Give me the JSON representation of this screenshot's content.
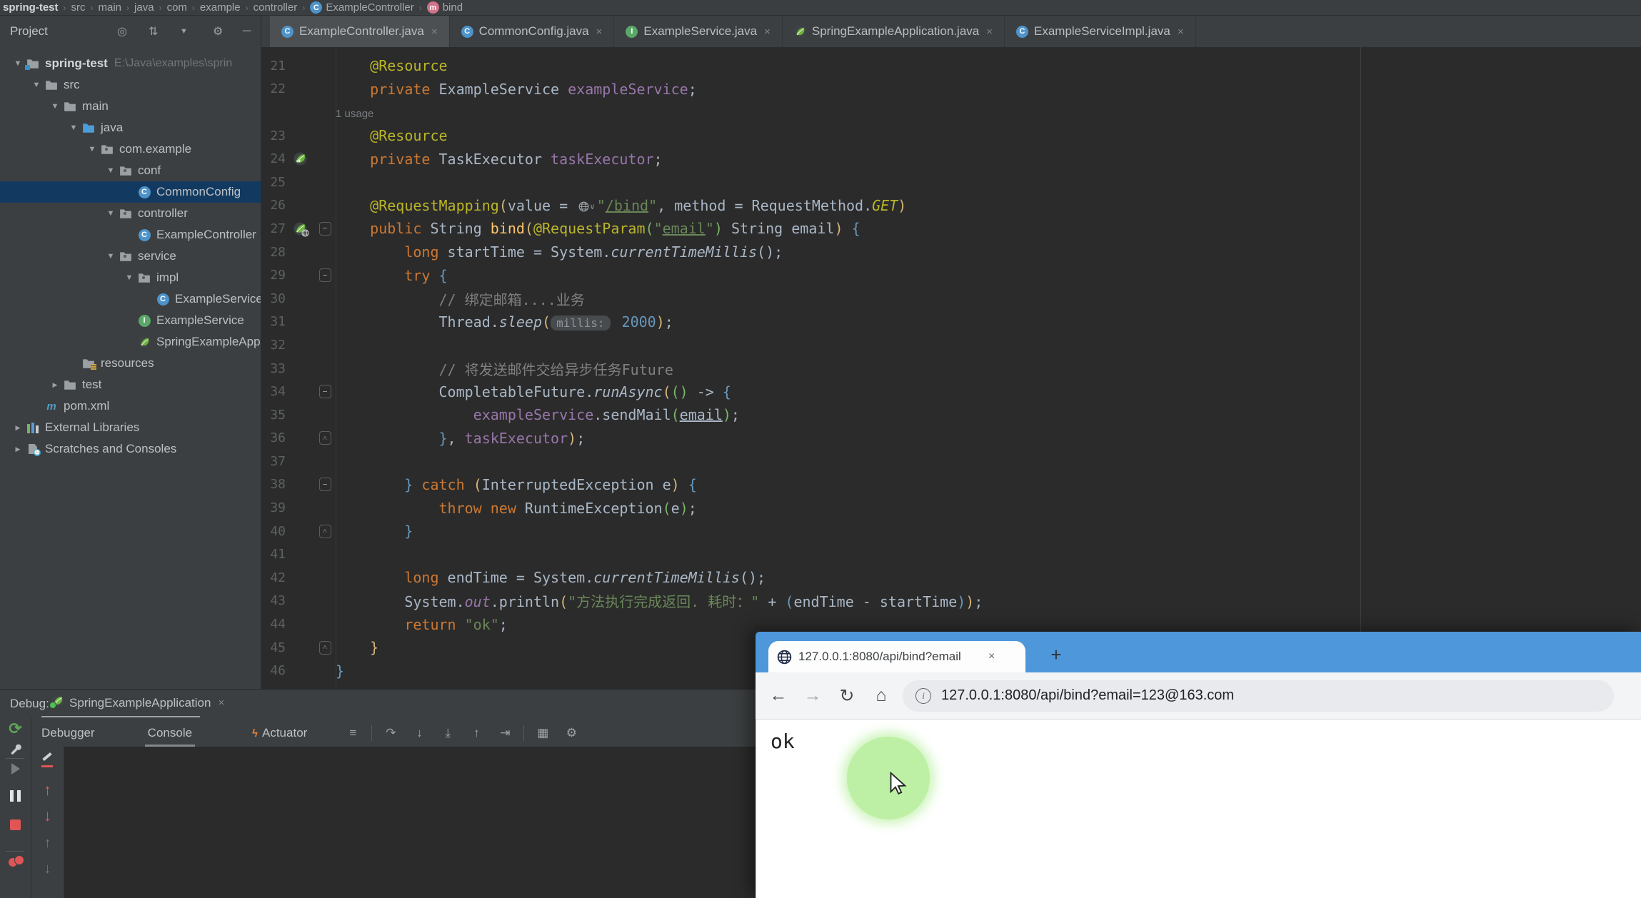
{
  "palette": {
    "ide_panel": "#3c3f41",
    "editor_bg": "#2b2b2b",
    "selection_blue": "#123a61",
    "spring_green": "#6db33f",
    "browser_blue": "#4d97da",
    "click_highlight": "#bdf0a5",
    "keyword_orange": "#cc7832",
    "annotation_olive": "#bbb529",
    "string_green": "#6a8759",
    "field_purple": "#9876aa",
    "number_blue": "#6897bb",
    "stop_red": "#c75450"
  },
  "breadcrumbs": {
    "items": [
      {
        "label": "spring-test",
        "icon": null
      },
      {
        "label": "src",
        "icon": null
      },
      {
        "label": "main",
        "icon": null
      },
      {
        "label": "java",
        "icon": null
      },
      {
        "label": "com",
        "icon": null
      },
      {
        "label": "example",
        "icon": null
      },
      {
        "label": "controller",
        "icon": null
      },
      {
        "label": "ExampleController",
        "icon": "class"
      },
      {
        "label": "bind",
        "icon": "method"
      }
    ]
  },
  "project_panel": {
    "title": "Project",
    "header_icons": [
      "locate",
      "collapse",
      "chevron-down",
      "settings",
      "hide"
    ],
    "tree": [
      {
        "lvl": 0,
        "arrow": "v",
        "icon": "module",
        "label": "spring-test",
        "path": "E:\\Java\\examples\\sprin",
        "bold": true,
        "sel": false
      },
      {
        "lvl": 1,
        "arrow": "v",
        "icon": "folder",
        "label": "src",
        "path": "",
        "bold": false,
        "sel": false
      },
      {
        "lvl": 2,
        "arrow": "v",
        "icon": "folder",
        "label": "main",
        "path": "",
        "bold": false,
        "sel": false
      },
      {
        "lvl": 3,
        "arrow": "v",
        "icon": "srcfolder",
        "label": "java",
        "path": "",
        "bold": false,
        "sel": false
      },
      {
        "lvl": 4,
        "arrow": "v",
        "icon": "package",
        "label": "com.example",
        "path": "",
        "bold": false,
        "sel": false
      },
      {
        "lvl": 5,
        "arrow": "v",
        "icon": "package",
        "label": "conf",
        "path": "",
        "bold": false,
        "sel": false
      },
      {
        "lvl": 6,
        "arrow": "",
        "icon": "class",
        "label": "CommonConfig",
        "path": "",
        "bold": false,
        "sel": true
      },
      {
        "lvl": 5,
        "arrow": "v",
        "icon": "package",
        "label": "controller",
        "path": "",
        "bold": false,
        "sel": false
      },
      {
        "lvl": 6,
        "arrow": "",
        "icon": "class",
        "label": "ExampleController",
        "path": "",
        "bold": false,
        "sel": false
      },
      {
        "lvl": 5,
        "arrow": "v",
        "icon": "package",
        "label": "service",
        "path": "",
        "bold": false,
        "sel": false
      },
      {
        "lvl": 6,
        "arrow": "v",
        "icon": "package",
        "label": "impl",
        "path": "",
        "bold": false,
        "sel": false
      },
      {
        "lvl": 7,
        "arrow": "",
        "icon": "class",
        "label": "ExampleServiceImpl",
        "path": "",
        "bold": false,
        "sel": false
      },
      {
        "lvl": 6,
        "arrow": "",
        "icon": "interface",
        "label": "ExampleService",
        "path": "",
        "bold": false,
        "sel": false
      },
      {
        "lvl": 6,
        "arrow": "",
        "icon": "spring",
        "label": "SpringExampleApplication",
        "path": "",
        "bold": false,
        "sel": false
      },
      {
        "lvl": 3,
        "arrow": "",
        "icon": "resources",
        "label": "resources",
        "path": "",
        "bold": false,
        "sel": false
      },
      {
        "lvl": 2,
        "arrow": ">",
        "icon": "folder",
        "label": "test",
        "path": "",
        "bold": false,
        "sel": false
      },
      {
        "lvl": 1,
        "arrow": "",
        "icon": "maven",
        "label": "pom.xml",
        "path": "",
        "bold": false,
        "sel": false
      },
      {
        "lvl": 0,
        "arrow": ">",
        "icon": "libs",
        "label": "External Libraries",
        "path": "",
        "bold": false,
        "sel": false
      },
      {
        "lvl": 0,
        "arrow": ">",
        "icon": "scratch",
        "label": "Scratches and Consoles",
        "path": "",
        "bold": false,
        "sel": false
      }
    ]
  },
  "editor_tabs": [
    {
      "icon": "class",
      "label": "ExampleController.java",
      "active": true
    },
    {
      "icon": "class",
      "label": "CommonConfig.java",
      "active": false
    },
    {
      "icon": "interface",
      "label": "ExampleService.java",
      "active": false
    },
    {
      "icon": "spring",
      "label": "SpringExampleApplication.java",
      "active": false
    },
    {
      "icon": "class",
      "label": "ExampleServiceImpl.java",
      "active": false
    }
  ],
  "editor": {
    "lines": [
      {
        "num": "21",
        "gicon": null,
        "fold": null,
        "segs": [
          [
            "def",
            "    "
          ],
          [
            "ann",
            "@Resource"
          ]
        ]
      },
      {
        "num": "22",
        "gicon": null,
        "fold": null,
        "segs": [
          [
            "def",
            "    "
          ],
          [
            "kw",
            "private"
          ],
          [
            "def",
            " ExampleService "
          ],
          [
            "fld",
            "exampleService"
          ],
          [
            "def",
            ";"
          ]
        ]
      },
      {
        "num": "",
        "gicon": null,
        "fold": null,
        "usage": "1 usage",
        "segs": []
      },
      {
        "num": "23",
        "gicon": null,
        "fold": null,
        "segs": [
          [
            "def",
            "    "
          ],
          [
            "ann",
            "@Resource"
          ]
        ]
      },
      {
        "num": "24",
        "gicon": "bean",
        "fold": null,
        "segs": [
          [
            "def",
            "    "
          ],
          [
            "kw",
            "private"
          ],
          [
            "def",
            " TaskExecutor "
          ],
          [
            "fld",
            "taskExecutor"
          ],
          [
            "def",
            ";"
          ]
        ]
      },
      {
        "num": "25",
        "gicon": null,
        "fold": null,
        "segs": []
      },
      {
        "num": "26",
        "gicon": null,
        "fold": null,
        "segs": [
          [
            "def",
            "    "
          ],
          [
            "ann",
            "@RequestMapping"
          ],
          [
            "py",
            "("
          ],
          [
            "def",
            "value = "
          ],
          [
            "globe",
            ""
          ],
          [
            "str",
            "\""
          ],
          [
            "strU",
            "/bind"
          ],
          [
            "str",
            "\""
          ],
          [
            "def",
            ", method = RequestMethod."
          ],
          [
            "cst",
            "GET"
          ],
          [
            "py",
            ")"
          ]
        ]
      },
      {
        "num": "27",
        "gicon": "mapping",
        "fold": "open",
        "segs": [
          [
            "def",
            "    "
          ],
          [
            "kw",
            "public"
          ],
          [
            "def",
            " String "
          ],
          [
            "mth",
            "bind"
          ],
          [
            "py",
            "("
          ],
          [
            "ann",
            "@RequestParam"
          ],
          [
            "pg",
            "("
          ],
          [
            "str",
            "\""
          ],
          [
            "strU",
            "email"
          ],
          [
            "str",
            "\""
          ],
          [
            "pg",
            ")"
          ],
          [
            "def",
            " String email"
          ],
          [
            "py",
            ")"
          ],
          [
            "def",
            " "
          ],
          [
            "pb",
            "{"
          ]
        ]
      },
      {
        "num": "28",
        "gicon": null,
        "fold": null,
        "segs": [
          [
            "def",
            "        "
          ],
          [
            "kw",
            "long"
          ],
          [
            "def",
            " startTime = System."
          ],
          [
            "itl",
            "currentTimeMillis"
          ],
          [
            "def",
            "();"
          ]
        ]
      },
      {
        "num": "29",
        "gicon": null,
        "fold": "open",
        "segs": [
          [
            "def",
            "        "
          ],
          [
            "kw",
            "try"
          ],
          [
            "def",
            " "
          ],
          [
            "pb",
            "{"
          ]
        ]
      },
      {
        "num": "30",
        "gicon": null,
        "fold": null,
        "segs": [
          [
            "def",
            "            "
          ],
          [
            "cmt",
            "// 绑定邮箱....业务"
          ]
        ]
      },
      {
        "num": "31",
        "gicon": null,
        "fold": null,
        "segs": [
          [
            "def",
            "            "
          ],
          [
            "def",
            "Thread."
          ],
          [
            "itl",
            "sleep"
          ],
          [
            "py",
            "("
          ],
          [
            "chip",
            "millis:"
          ],
          [
            "def",
            " "
          ],
          [
            "num2",
            "2000"
          ],
          [
            "py",
            ")"
          ],
          [
            "def",
            ";"
          ]
        ]
      },
      {
        "num": "32",
        "gicon": null,
        "fold": null,
        "segs": []
      },
      {
        "num": "33",
        "gicon": null,
        "fold": null,
        "segs": [
          [
            "def",
            "            "
          ],
          [
            "cmt",
            "// 将发送邮件交给异步任务Future"
          ]
        ]
      },
      {
        "num": "34",
        "gicon": null,
        "fold": "open",
        "segs": [
          [
            "def",
            "            "
          ],
          [
            "def",
            "CompletableFuture."
          ],
          [
            "itl",
            "runAsync"
          ],
          [
            "py",
            "("
          ],
          [
            "pg",
            "()"
          ],
          [
            "def",
            " -> "
          ],
          [
            "pb",
            "{"
          ]
        ]
      },
      {
        "num": "35",
        "gicon": null,
        "fold": null,
        "segs": [
          [
            "def",
            "                "
          ],
          [
            "fld",
            "exampleService"
          ],
          [
            "def",
            ".sendMail"
          ],
          [
            "pg",
            "("
          ],
          [
            "defU",
            "email"
          ],
          [
            "pg",
            ")"
          ],
          [
            "def",
            ";"
          ]
        ]
      },
      {
        "num": "36",
        "gicon": null,
        "fold": "end",
        "segs": [
          [
            "def",
            "            "
          ],
          [
            "pb",
            "}"
          ],
          [
            "def",
            ", "
          ],
          [
            "fld",
            "taskExecutor"
          ],
          [
            "py",
            ")"
          ],
          [
            "def",
            ";"
          ]
        ]
      },
      {
        "num": "37",
        "gicon": null,
        "fold": null,
        "segs": []
      },
      {
        "num": "38",
        "gicon": null,
        "fold": "open",
        "segs": [
          [
            "def",
            "        "
          ],
          [
            "pb",
            "}"
          ],
          [
            "def",
            " "
          ],
          [
            "kw",
            "catch"
          ],
          [
            "def",
            " "
          ],
          [
            "py",
            "("
          ],
          [
            "def",
            "InterruptedException e"
          ],
          [
            "py",
            ")"
          ],
          [
            "def",
            " "
          ],
          [
            "pb",
            "{"
          ]
        ]
      },
      {
        "num": "39",
        "gicon": null,
        "fold": null,
        "segs": [
          [
            "def",
            "            "
          ],
          [
            "kw",
            "throw"
          ],
          [
            "def",
            " "
          ],
          [
            "kw",
            "new"
          ],
          [
            "def",
            " RuntimeException"
          ],
          [
            "pg",
            "("
          ],
          [
            "def",
            "e"
          ],
          [
            "pg",
            ")"
          ],
          [
            "def",
            ";"
          ]
        ]
      },
      {
        "num": "40",
        "gicon": null,
        "fold": "end",
        "segs": [
          [
            "def",
            "        "
          ],
          [
            "pb",
            "}"
          ]
        ]
      },
      {
        "num": "41",
        "gicon": null,
        "fold": null,
        "segs": []
      },
      {
        "num": "42",
        "gicon": null,
        "fold": null,
        "segs": [
          [
            "def",
            "        "
          ],
          [
            "kw",
            "long"
          ],
          [
            "def",
            " endTime = System."
          ],
          [
            "itl",
            "currentTimeMillis"
          ],
          [
            "def",
            "();"
          ]
        ]
      },
      {
        "num": "43",
        "gicon": null,
        "fold": null,
        "segs": [
          [
            "def",
            "        "
          ],
          [
            "def",
            "System."
          ],
          [
            "itlf",
            "out"
          ],
          [
            "def",
            ".println"
          ],
          [
            "py",
            "("
          ],
          [
            "str",
            "\"方法执行完成返回. 耗时：\""
          ],
          [
            "def",
            " + "
          ],
          [
            "pb",
            "("
          ],
          [
            "def",
            "endTime - startTime"
          ],
          [
            "pb",
            ")"
          ],
          [
            "py",
            ")"
          ],
          [
            "def",
            ";"
          ]
        ]
      },
      {
        "num": "44",
        "gicon": null,
        "fold": null,
        "segs": [
          [
            "def",
            "        "
          ],
          [
            "kw",
            "return"
          ],
          [
            "def",
            " "
          ],
          [
            "str",
            "\"ok\""
          ],
          [
            "def",
            ";"
          ]
        ]
      },
      {
        "num": "45",
        "gicon": null,
        "fold": "end",
        "segs": [
          [
            "def",
            "    "
          ],
          [
            "py",
            "}"
          ]
        ]
      },
      {
        "num": "46",
        "gicon": null,
        "fold": null,
        "segs": [
          [
            "pb",
            "}"
          ]
        ]
      }
    ]
  },
  "debug_panel": {
    "label": "Debug:",
    "config_name": "SpringExampleApplication",
    "tabs": [
      {
        "label": "Debugger",
        "active": false,
        "icon": null
      },
      {
        "label": "Console",
        "active": true,
        "icon": null
      },
      {
        "label": "Actuator",
        "active": false,
        "icon": "actuator"
      }
    ],
    "toolbar_icons": [
      "list",
      "sep",
      "step-over",
      "step-into",
      "force-step-into",
      "step-out",
      "run-to-cursor",
      "sep",
      "evaluate",
      "settings"
    ],
    "left_icons": [
      "rerun",
      "wrench",
      "sep",
      "resume",
      "pause",
      "stop",
      "sep",
      "breakpoints"
    ],
    "side_icons": [
      "hotswap",
      "arrow-up-red",
      "arrow-down-red",
      "arrow-up-dim",
      "arrow-down-dim"
    ]
  },
  "browser": {
    "tab_title": "127.0.0.1:8080/api/bind?email",
    "tab_close": "×",
    "new_tab": "+",
    "info_glyph": "i",
    "url": "127.0.0.1:8080/api/bind?email=123@163.com",
    "body_text": "ok"
  }
}
